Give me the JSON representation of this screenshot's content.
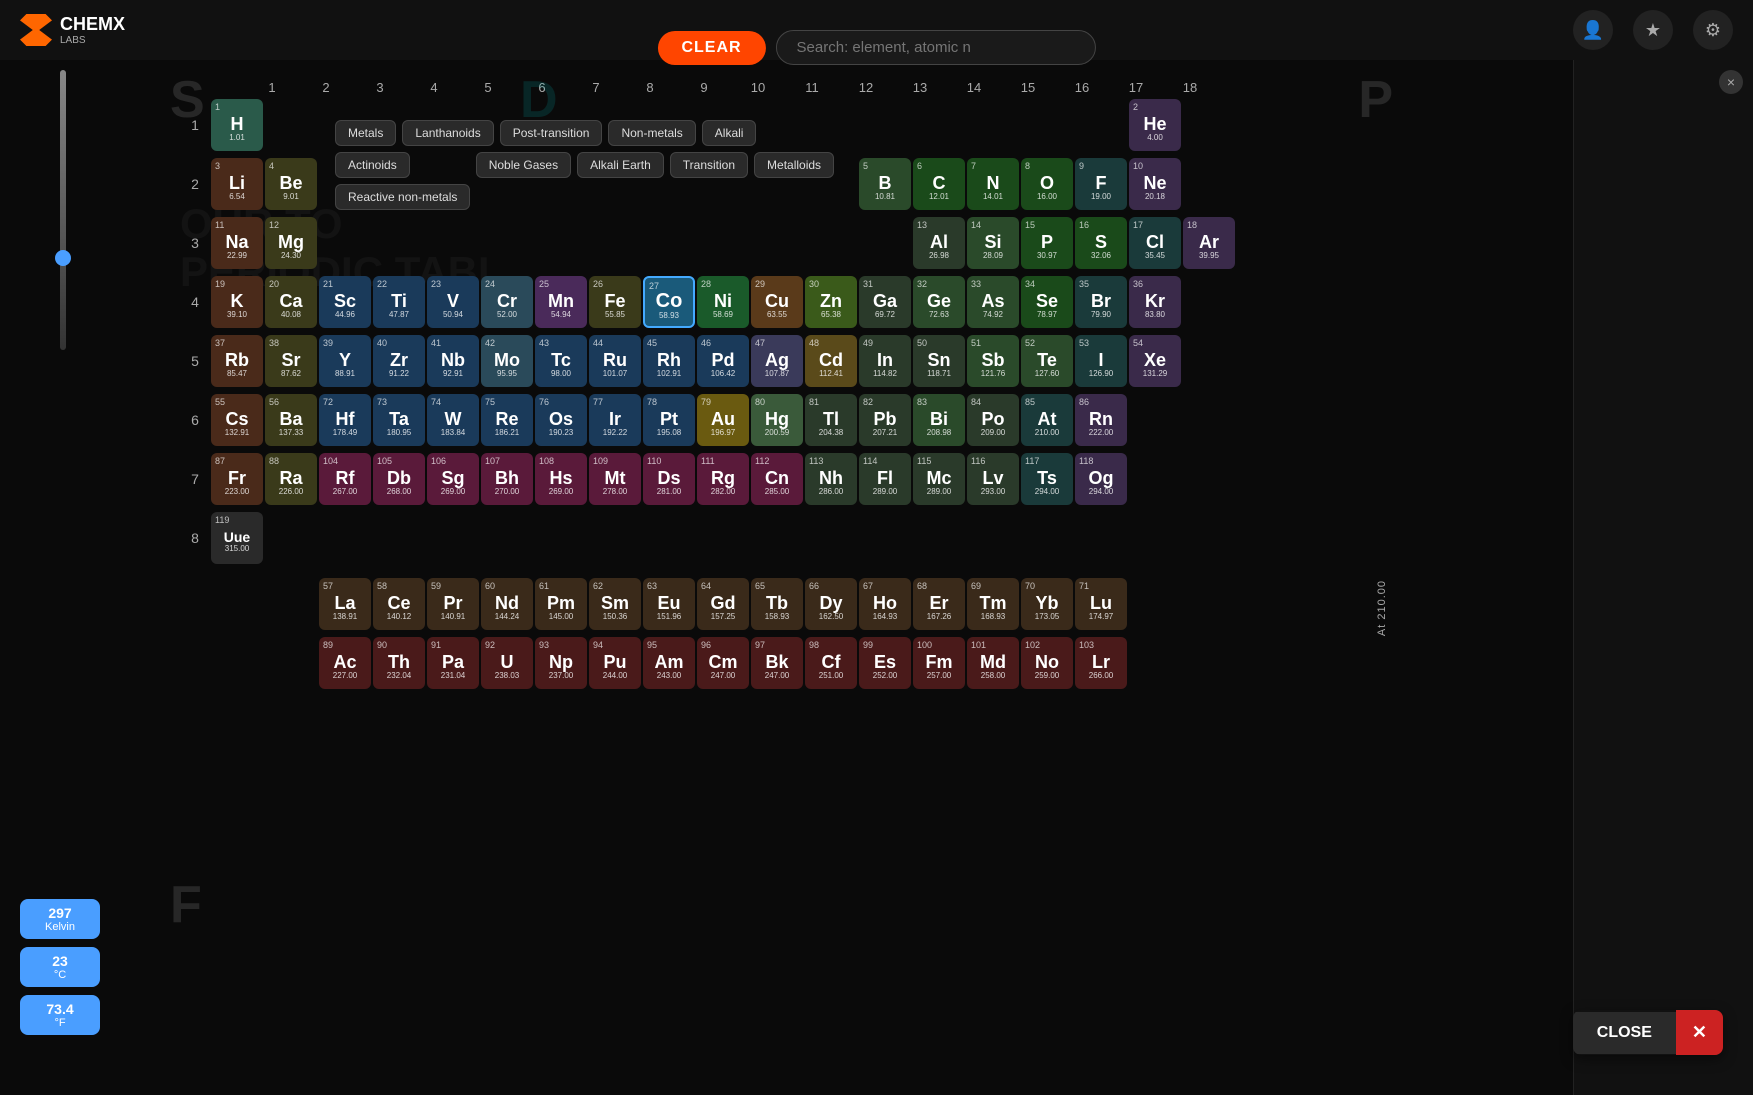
{
  "app": {
    "title": "CHEMX",
    "subtitle": "LABS"
  },
  "toolbar": {
    "clear_label": "CLEAR",
    "search_placeholder": "Search: element, atomic n"
  },
  "block_labels": {
    "s": "S",
    "d": "D",
    "p": "P",
    "f": "F"
  },
  "group_numbers": [
    1,
    2,
    3,
    4,
    5,
    6,
    7,
    8,
    9,
    10,
    11,
    12,
    13,
    14,
    15,
    16,
    17,
    18
  ],
  "period_numbers": [
    1,
    2,
    3,
    4,
    5,
    6,
    7,
    8
  ],
  "temperature": {
    "kelvin": 297,
    "celsius": 23,
    "fahrenheit": 73.4,
    "kelvin_unit": "Kelvin",
    "celsius_unit": "°C",
    "fahrenheit_unit": "°F"
  },
  "at_temp_label": "At 210.00",
  "legend": {
    "items": [
      {
        "id": "metals",
        "label": "Metals"
      },
      {
        "id": "lanthanoids",
        "label": "Lanthanoids"
      },
      {
        "id": "post-transition",
        "label": "Post-transition"
      },
      {
        "id": "non-metals",
        "label": "Non-metals"
      },
      {
        "id": "alkali",
        "label": "Alkali"
      },
      {
        "id": "actinoids",
        "label": "Actinoids"
      },
      {
        "id": "noble-gases",
        "label": "Noble Gases"
      },
      {
        "id": "alkali-earth",
        "label": "Alkali Earth"
      },
      {
        "id": "transition",
        "label": "Transition"
      },
      {
        "id": "metalloids",
        "label": "Metalloids"
      },
      {
        "id": "reactive-non-metals",
        "label": "Reactive non-metals"
      }
    ]
  },
  "close_button": {
    "label": "CLOSE"
  },
  "elements": {
    "period1": [
      {
        "num": 1,
        "sym": "H",
        "weight": "1.01",
        "type": "h-elem",
        "col": 1
      },
      {
        "num": 2,
        "sym": "He",
        "weight": "4.00",
        "type": "noble",
        "col": 18
      }
    ],
    "period2": [
      {
        "num": 3,
        "sym": "Li",
        "weight": "6.54",
        "type": "alkali",
        "col": 1
      },
      {
        "num": 4,
        "sym": "Be",
        "weight": "9.01",
        "type": "alkali-earth",
        "col": 2
      },
      {
        "num": 5,
        "sym": "B",
        "weight": "10.81",
        "type": "metalloid",
        "col": 13
      },
      {
        "num": 6,
        "sym": "C",
        "weight": "12.01",
        "type": "nonmetal",
        "col": 14
      },
      {
        "num": 7,
        "sym": "N",
        "weight": "14.01",
        "type": "nonmetal",
        "col": 15
      },
      {
        "num": 8,
        "sym": "O",
        "weight": "16.00",
        "type": "nonmetal",
        "col": 16
      },
      {
        "num": 9,
        "sym": "F",
        "weight": "19.00",
        "type": "halogen",
        "col": 17
      },
      {
        "num": 10,
        "sym": "Ne",
        "weight": "20.18",
        "type": "noble",
        "col": 18
      }
    ],
    "period3": [
      {
        "num": 11,
        "sym": "Na",
        "weight": "22.99",
        "type": "alkali",
        "col": 1
      },
      {
        "num": 12,
        "sym": "Mg",
        "weight": "24.30",
        "type": "alkali-earth",
        "col": 2
      },
      {
        "num": 13,
        "sym": "Al",
        "weight": "26.98",
        "type": "post-transition",
        "col": 13
      },
      {
        "num": 14,
        "sym": "Si",
        "weight": "28.09",
        "type": "metalloid",
        "col": 14
      },
      {
        "num": 15,
        "sym": "P",
        "weight": "30.97",
        "type": "nonmetal",
        "col": 15
      },
      {
        "num": 16,
        "sym": "S",
        "weight": "32.06",
        "type": "nonmetal",
        "col": 16
      },
      {
        "num": 17,
        "sym": "Cl",
        "weight": "35.45",
        "type": "halogen",
        "col": 17
      },
      {
        "num": 18,
        "sym": "Ar",
        "weight": "39.95",
        "type": "noble",
        "col": 18
      }
    ]
  },
  "transition_label": "Transition"
}
